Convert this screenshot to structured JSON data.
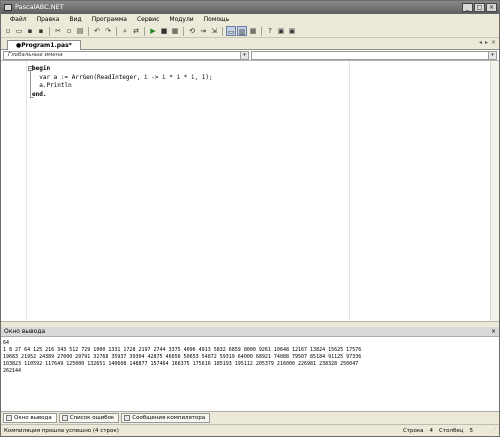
{
  "window": {
    "title": "PascalABC.NET",
    "controls": [
      "_",
      "□",
      "×"
    ]
  },
  "menu": [
    "Файл",
    "Правка",
    "Вид",
    "Программа",
    "Сервис",
    "Модули",
    "Помощь"
  ],
  "toolbar": {
    "icons": [
      "new-file-icon",
      "open-folder-icon",
      "save-icon",
      "save-all-icon",
      "cut-icon",
      "copy-icon",
      "paste-icon",
      "undo-icon",
      "redo-icon",
      "find-icon",
      "replace-icon",
      "run-icon",
      "stop-icon",
      "compile-icon",
      "debug-icon",
      "step-over-icon",
      "step-into-icon",
      "layout-one-icon",
      "layout-two-icon",
      "layout-three-icon",
      "help-icon",
      "navigate-icon",
      "navigate-icon-2"
    ]
  },
  "tabs": [
    {
      "label": "●Program1.pas*"
    }
  ],
  "tabnav": [
    "◂",
    "▸",
    "×"
  ],
  "editor": {
    "scope_combo": "Глобальные имена",
    "code_lines": [
      {
        "kw": "begin",
        "text": ""
      },
      {
        "kw": "",
        "text": "  var a := ArrGen(ReadInteger, i -> i * i * i, 1);"
      },
      {
        "kw": "",
        "text": "  a.Println"
      },
      {
        "kw": "end.",
        "text": ""
      }
    ]
  },
  "output": {
    "header": "Окно вывода",
    "lines": [
      "64",
      "1 8 27 64 125 216 343 512 729 1000 1331 1728 2197 2744 3375 4096 4913 5832 6859 8000 9261 10648 12167 13824 15625 17576",
      "19683 21952 24389 27000 29791 32768 35937 39304 42875 46656 50653 54872 59319 64000 68921 74088 79507 85184 91125 97336",
      "103823 110592 117649 125000 132651 140608 148877 157464 166375 175616 185193 195112 205379 216000 226981 238328 250047",
      "262144"
    ]
  },
  "bottom_tabs": [
    "Окно вывода",
    "Список ошибок",
    "Сообщения компилятора"
  ],
  "status": {
    "message": "Компиляция прошла успешно (4 строк)",
    "row_label": "Строка",
    "row_value": "4",
    "col_label": "Столбец",
    "col_value": "5"
  }
}
